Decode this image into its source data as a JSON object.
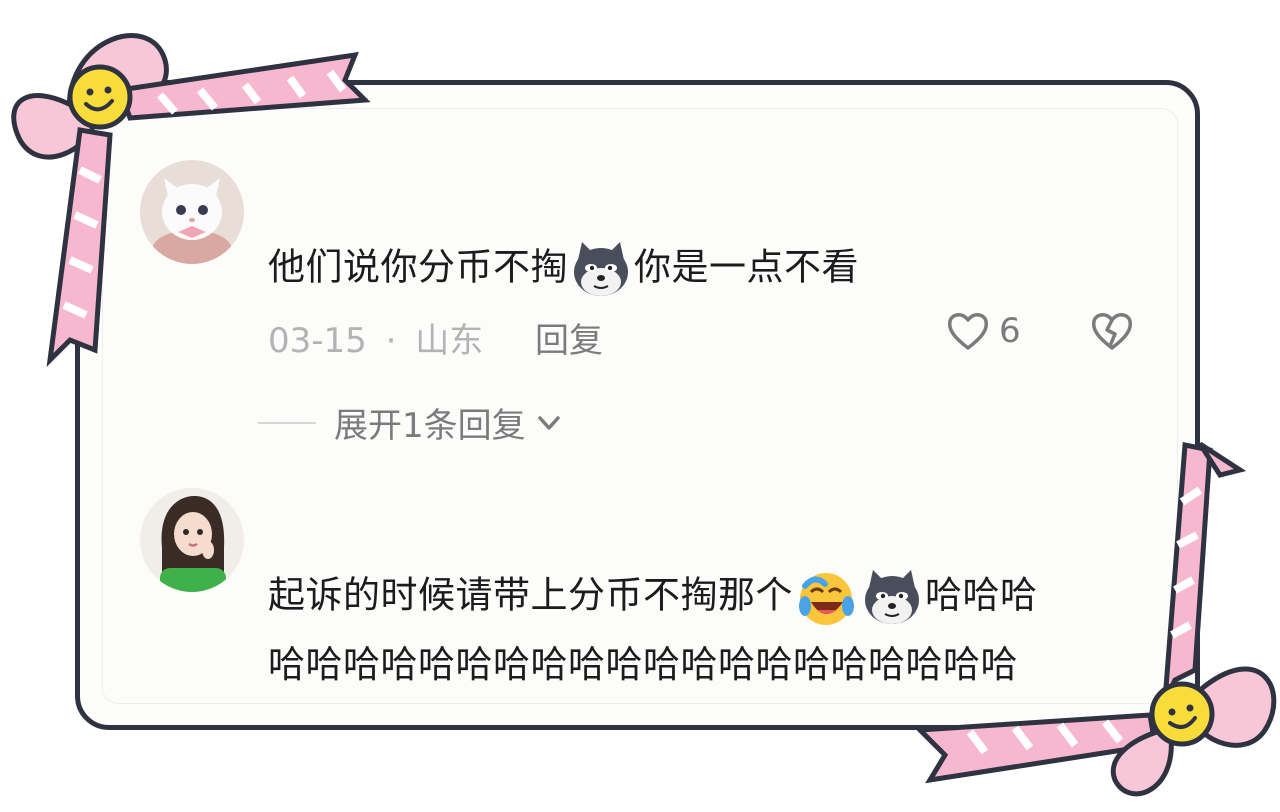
{
  "comments": [
    {
      "text_before": "他们说你分币不掏",
      "text_after": "你是一点不看",
      "date": "03-15",
      "location": "山东",
      "separator": "·",
      "reply_label": "回复",
      "likes": "6",
      "avatar_icon": "white-kitten-avatar",
      "expand_label": "展开1条回复"
    },
    {
      "line1_text": "起诉的时候请带上分币不掏那个",
      "line1_tail": "哈哈哈",
      "line2_text": "哈哈哈哈哈哈哈哈哈哈哈哈哈哈哈哈哈哈哈哈",
      "avatar_icon": "cartoon-girl-avatar"
    }
  ],
  "colors": {
    "frame": "#2f3341",
    "ribbon": "#f7b8cf",
    "smiley": "#f8dd3a",
    "muted": "#b3b3b3",
    "secondary": "#7b7b7b"
  }
}
